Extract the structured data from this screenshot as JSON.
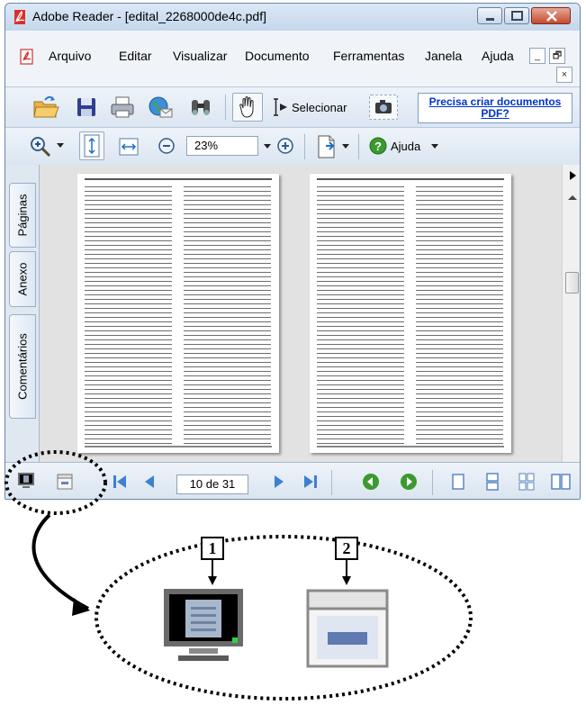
{
  "window": {
    "title": "Adobe Reader - [edital_2268000de4c.pdf]",
    "controls": {
      "minimize": "minimize-icon",
      "maximize": "maximize-icon",
      "close": "close-icon"
    }
  },
  "menu": {
    "items": [
      "Arquivo",
      "Editar",
      "Visualizar",
      "Documento",
      "Ferramentas",
      "Janela",
      "Ajuda"
    ],
    "mdi_minimize": "_",
    "mdi_restore": "🗗",
    "mdi_close": "×"
  },
  "toolbar": {
    "select_label": "Selecionar",
    "promo_line1": "Precisa criar documentos",
    "promo_line2": "PDF?",
    "zoom_value": "23%",
    "help_label": "Ajuda"
  },
  "sidebar": {
    "tabs": [
      "Páginas",
      "Anexo",
      "Comentários"
    ]
  },
  "navigation": {
    "page_display": "10 de 31"
  },
  "callouts": {
    "label_1": "1",
    "label_2": "2"
  },
  "colors": {
    "accent_link": "#0033cc",
    "window_frame": "#cfdff0",
    "close_red": "#c34a2f"
  }
}
